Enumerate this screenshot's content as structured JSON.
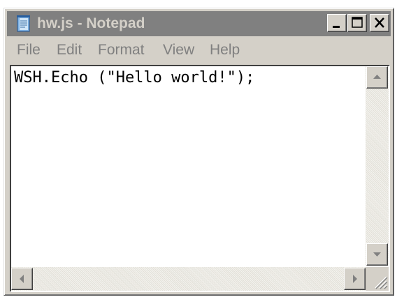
{
  "window": {
    "title": "hw.js - Notepad",
    "controls": {
      "minimize_icon": "minimize-icon",
      "maximize_icon": "maximize-icon",
      "close_icon": "close-icon"
    }
  },
  "menu": {
    "items": [
      "File",
      "Edit",
      "Format",
      "View",
      "Help"
    ]
  },
  "editor": {
    "content": "WSH.Echo (\"Hello world!\");"
  },
  "scrollbars": {
    "vertical": {
      "up_icon": "arrow-up-icon",
      "down_icon": "arrow-down-icon"
    },
    "horizontal": {
      "left_icon": "arrow-left-icon",
      "right_icon": "arrow-right-icon"
    }
  },
  "colors": {
    "titlebar_inactive": "#808080",
    "title_text": "#d4d0c8",
    "window_face": "#d4d0c8",
    "menu_text": "#808080",
    "editor_bg": "#ffffff"
  }
}
